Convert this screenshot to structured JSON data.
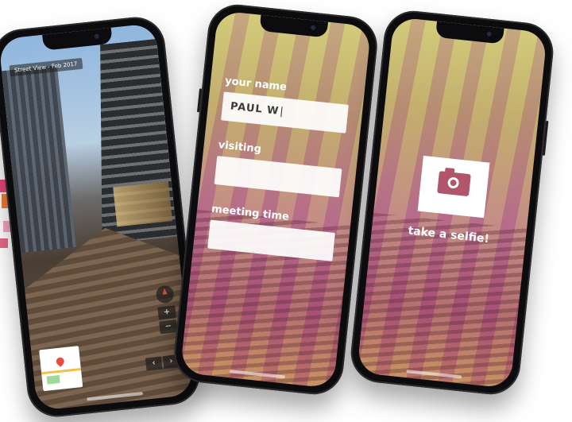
{
  "street_view": {
    "label": "Street View - Feb 2017",
    "zoom_in": "+",
    "zoom_out": "−",
    "prev": "‹",
    "next": "›",
    "icons": [
      "compass-icon",
      "zoom-in-icon",
      "zoom-out-icon",
      "chevron-left-icon",
      "chevron-right-icon",
      "map-pin-icon"
    ]
  },
  "form": {
    "name_label": "your name",
    "name_value": "PAUL W",
    "visiting_label": "visiting",
    "visiting_value": "",
    "meeting_label": "meeting time",
    "meeting_value": ""
  },
  "selfie": {
    "label": "take a selfie!",
    "icon": "camera-icon"
  },
  "colors": {
    "overlay_yellow": "#e8d65a",
    "overlay_magenta": "#b1566a",
    "field_bg": "#ffffff",
    "phone_body": "#0c0c0e"
  }
}
